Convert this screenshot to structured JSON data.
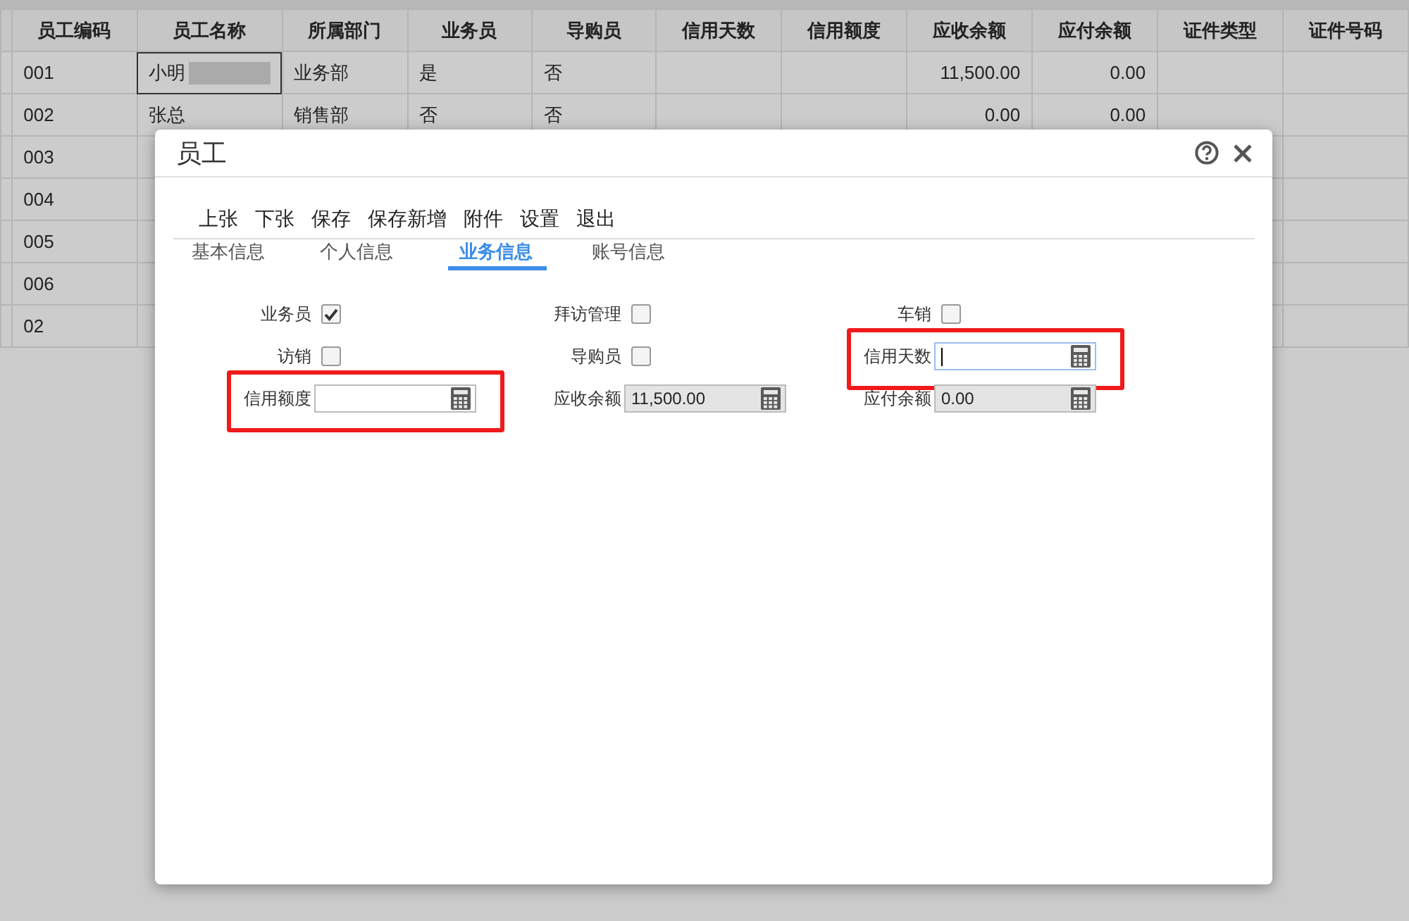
{
  "table": {
    "columns": [
      "员工编码",
      "员工名称",
      "所属部门",
      "业务员",
      "导购员",
      "信用天数",
      "信用额度",
      "应收余额",
      "应付余额",
      "证件类型",
      "证件号码"
    ],
    "rows": [
      {
        "code": "001",
        "name": "小明",
        "department": "业务部",
        "salesperson": "是",
        "shopping_guide": "否",
        "receivable": "11,500.00",
        "payable": "0.00",
        "selected": true,
        "redacted": true
      },
      {
        "code": "002",
        "name": "张总",
        "department": "销售部",
        "salesperson": "否",
        "shopping_guide": "否",
        "receivable": "0.00",
        "payable": "0.00",
        "selected": false,
        "redacted": false
      },
      {
        "code": "003",
        "selected": false,
        "redacted": false
      },
      {
        "code": "004",
        "selected": false,
        "redacted": false
      },
      {
        "code": "005",
        "selected": false,
        "redacted": false
      },
      {
        "code": "006",
        "selected": false,
        "redacted": false
      },
      {
        "code": "02",
        "selected": false,
        "redacted": false
      }
    ]
  },
  "dialog": {
    "title": "员工",
    "toolbar": [
      "上张",
      "下张",
      "保存",
      "保存新增",
      "附件",
      "设置",
      "退出"
    ],
    "tabs": [
      {
        "label": "基本信息",
        "selected": false
      },
      {
        "label": "个人信息",
        "selected": false
      },
      {
        "label": "业务信息",
        "selected": true
      },
      {
        "label": "账号信息",
        "selected": false
      }
    ],
    "fields": [
      {
        "kind": "checkbox",
        "label": "业务员",
        "checked": true
      },
      {
        "kind": "checkbox",
        "label": "拜访管理",
        "checked": false
      },
      {
        "kind": "checkbox",
        "label": "车销",
        "checked": false
      },
      {
        "kind": "checkbox",
        "label": "访销",
        "checked": false
      },
      {
        "kind": "checkbox",
        "label": "导购员",
        "checked": false
      },
      {
        "kind": "input",
        "label": "信用天数",
        "disabled": false,
        "focused": true,
        "highlighted": true
      },
      {
        "kind": "input",
        "label": "信用额度",
        "disabled": false,
        "focused": false,
        "highlighted": true
      },
      {
        "kind": "input",
        "label": "应收余额",
        "value": "11,500.00",
        "disabled": true,
        "focused": false,
        "highlighted": false
      },
      {
        "kind": "input",
        "label": "应付余额",
        "value": "0.00",
        "disabled": true,
        "focused": false,
        "highlighted": false
      }
    ]
  }
}
